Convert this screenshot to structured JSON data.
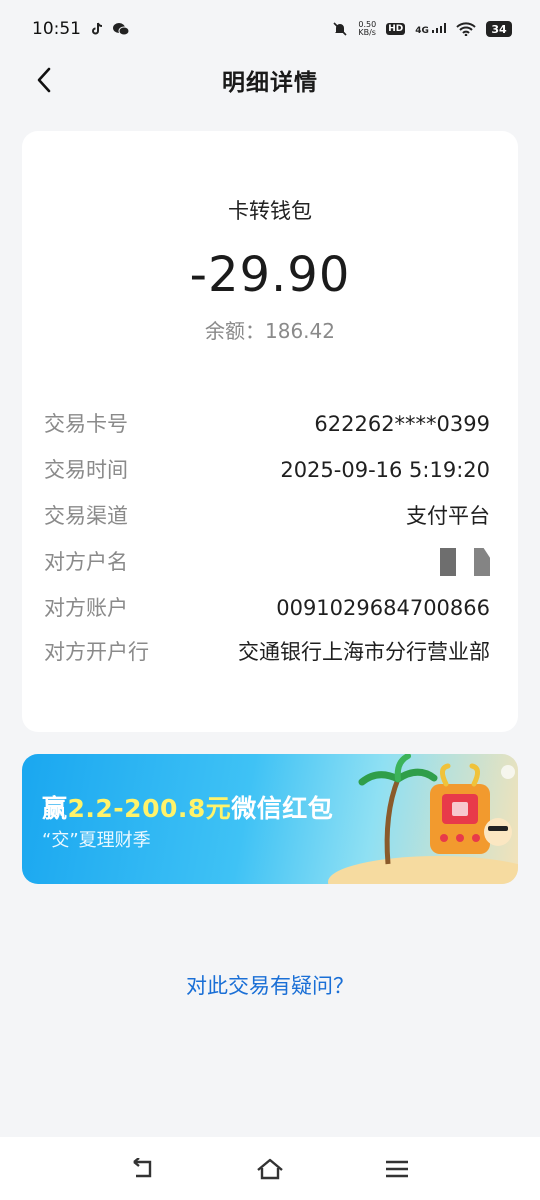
{
  "status_bar": {
    "time": "10:51",
    "speed_value": "0.50",
    "speed_unit": "KB/s",
    "hd": "HD",
    "network": "4G",
    "battery": "34"
  },
  "header": {
    "title": "明细详情"
  },
  "transaction": {
    "type": "卡转钱包",
    "amount": "-29.90",
    "balance_label": "余额：",
    "balance_value": "186.42"
  },
  "details": [
    {
      "label": "交易卡号",
      "value": "622262****0399"
    },
    {
      "label": "交易时间",
      "value": "2025-09-16 5:19:20"
    },
    {
      "label": "交易渠道",
      "value": "支付平台"
    },
    {
      "label": "对方户名",
      "value": ""
    },
    {
      "label": "对方账户",
      "value": "0091029684700866"
    },
    {
      "label": "对方开户行",
      "value": "交通银行上海市分行营业部"
    }
  ],
  "banner": {
    "prefix": "赢",
    "amount_range": "2.2-200.8元",
    "suffix": "微信红包",
    "subtitle": "“交”夏理财季"
  },
  "footer": {
    "question_link": "对此交易有疑问？"
  },
  "icons": {
    "back": "chevron-left-icon",
    "nav_back": "return-icon",
    "nav_home": "home-icon",
    "nav_menu": "menu-icon"
  }
}
